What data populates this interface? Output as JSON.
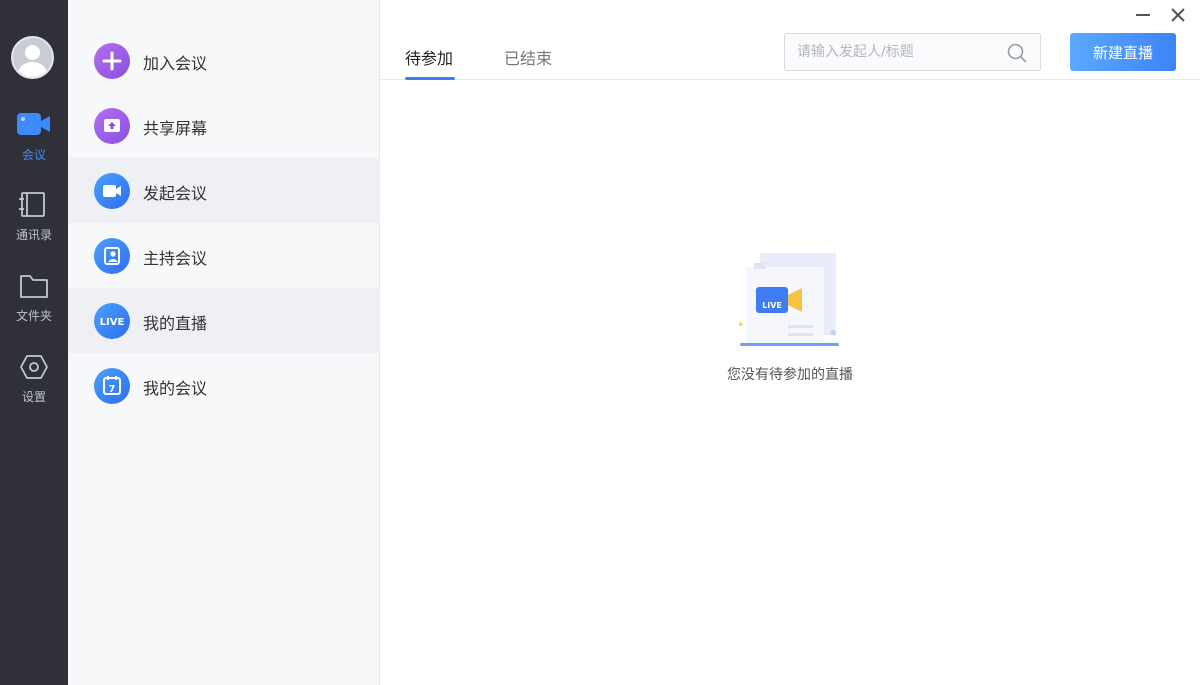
{
  "rail": {
    "items": [
      {
        "label": "会议",
        "icon": "video-camera-icon",
        "active": true
      },
      {
        "label": "通讯录",
        "icon": "address-book-icon"
      },
      {
        "label": "文件夹",
        "icon": "folder-icon"
      },
      {
        "label": "设置",
        "icon": "settings-hexagon-icon"
      }
    ]
  },
  "menu": {
    "items": [
      {
        "label": "加入会议",
        "icon": "plus-icon"
      },
      {
        "label": "共享屏幕",
        "icon": "share-screen-icon"
      },
      {
        "label": "发起会议",
        "icon": "video-camera-icon"
      },
      {
        "label": "主持会议",
        "icon": "host-user-icon"
      },
      {
        "label": "我的直播",
        "icon": "live-icon",
        "selected": true
      },
      {
        "label": "我的会议",
        "icon": "calendar-icon"
      }
    ],
    "live_badge": "LIVE",
    "calendar_day": "7"
  },
  "main": {
    "tabs": [
      {
        "label": "待参加",
        "active": true
      },
      {
        "label": "已结束"
      }
    ],
    "search": {
      "placeholder": "请输入发起人/标题"
    },
    "new_button": "新建直播",
    "empty": {
      "badge": "LIVE",
      "text": "您没有待参加的直播"
    }
  },
  "colors": {
    "accent": "#3a7ff5",
    "rail_bg": "#2f3038",
    "menu_bg": "#f7f8fa",
    "purple": "#9a5de8"
  }
}
